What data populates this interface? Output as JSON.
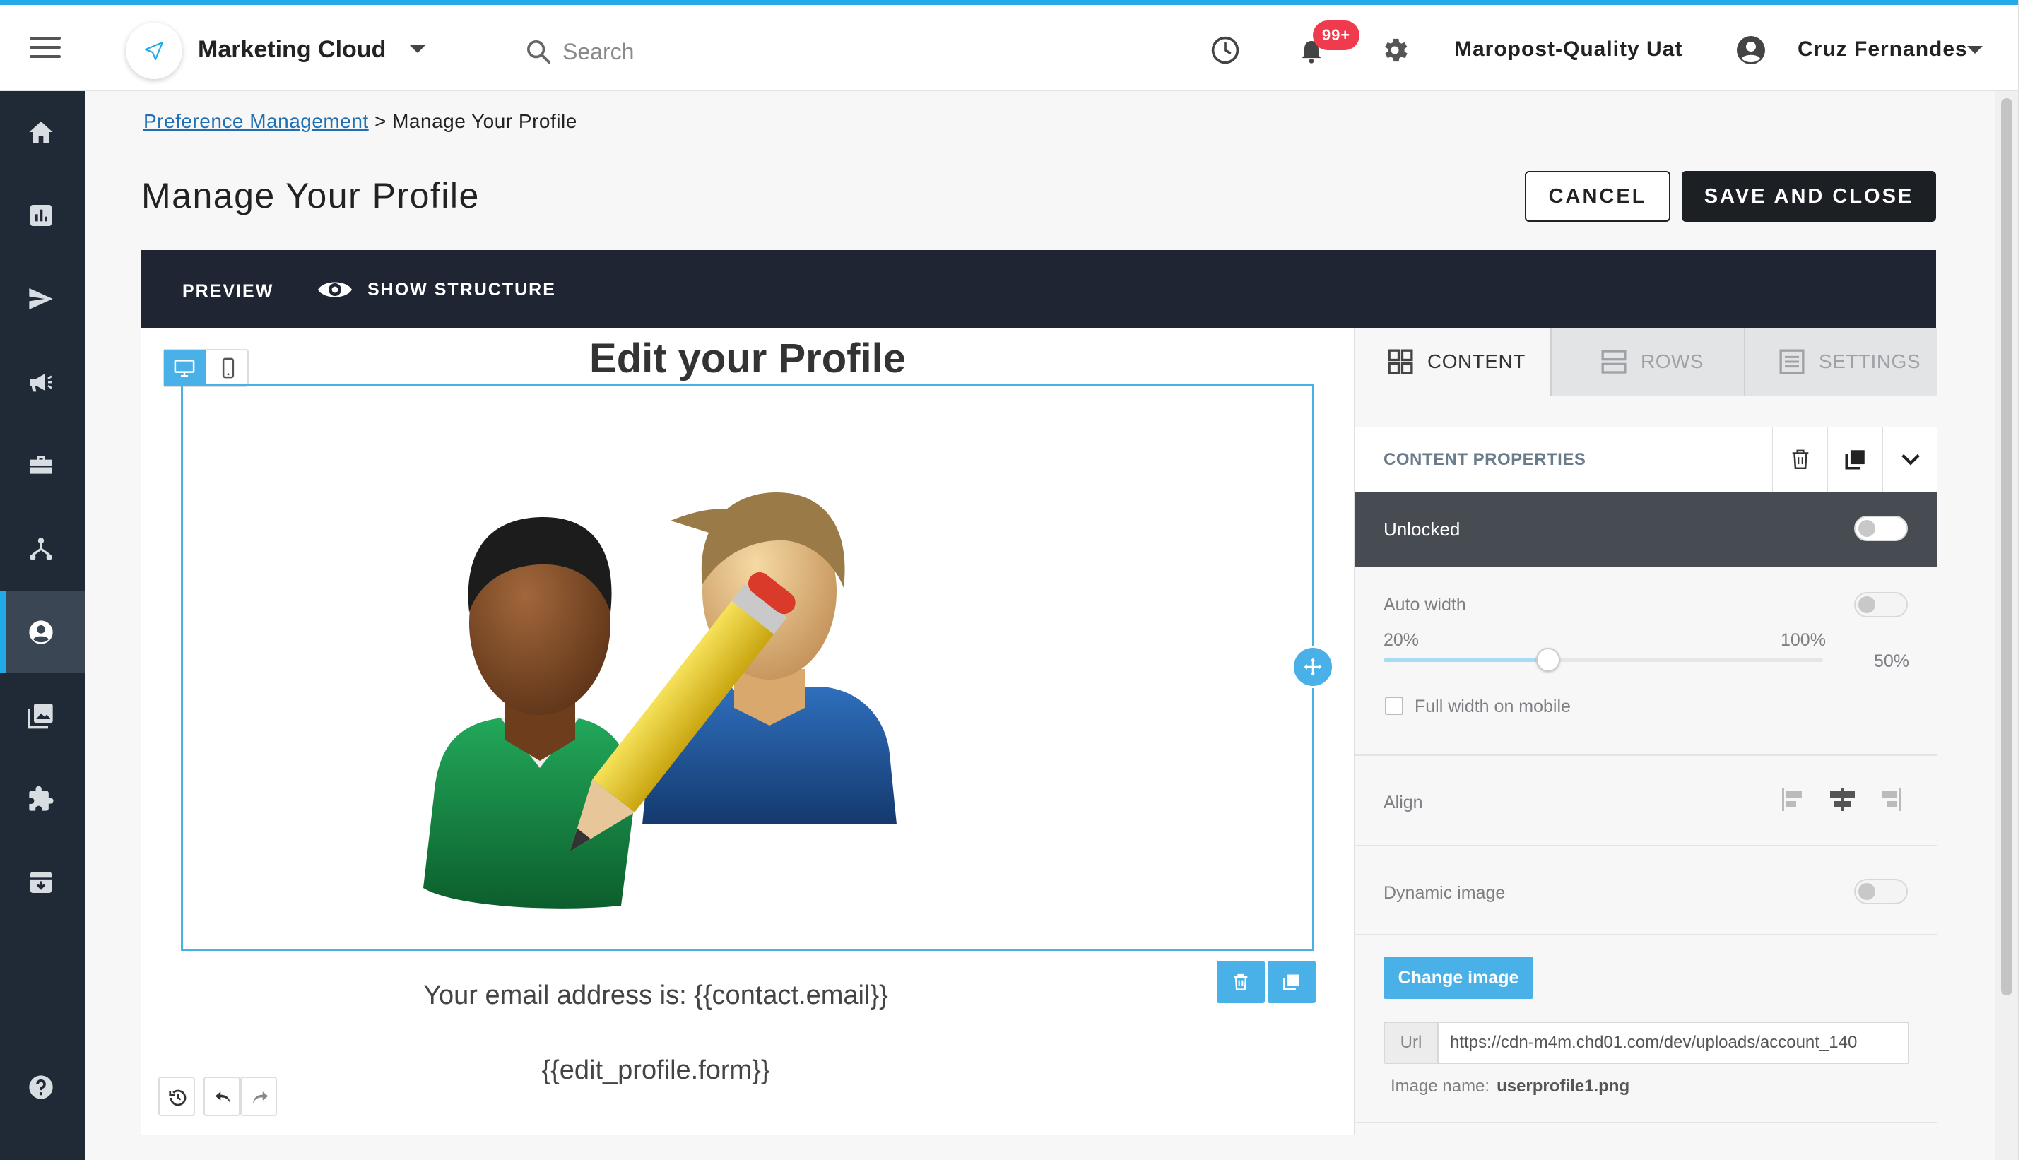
{
  "header": {
    "app_title": "Marketing Cloud",
    "search_placeholder": "Search",
    "notification_count": "99+",
    "account_name": "Maropost-Quality Uat",
    "user_name": "Cruz Fernandes"
  },
  "sidebar": {
    "items": [
      {
        "icon": "home-icon"
      },
      {
        "icon": "reports-icon"
      },
      {
        "icon": "send-icon"
      },
      {
        "icon": "megaphone-icon"
      },
      {
        "icon": "briefcase-icon"
      },
      {
        "icon": "journey-icon"
      },
      {
        "icon": "contact-icon",
        "active": true
      },
      {
        "icon": "gallery-icon"
      },
      {
        "icon": "puzzle-icon"
      },
      {
        "icon": "archive-icon"
      },
      {
        "icon": "help-icon"
      }
    ]
  },
  "breadcrumb": {
    "parent": "Preference Management",
    "separator": ">",
    "current": "Manage Your Profile"
  },
  "page": {
    "title": "Manage Your Profile",
    "cancel_label": "CANCEL",
    "save_label": "SAVE AND CLOSE"
  },
  "editor_bar": {
    "preview_label": "PREVIEW",
    "structure_label": "SHOW STRUCTURE"
  },
  "canvas": {
    "heading": "Edit your Profile",
    "email_text": "Your email address is: {{contact.email}}",
    "form_text": "{{edit_profile.form}}"
  },
  "panel": {
    "tabs": [
      {
        "label": "CONTENT",
        "icon": "grid-icon",
        "active": true
      },
      {
        "label": "ROWS",
        "icon": "rows-icon",
        "active": false
      },
      {
        "label": "SETTINGS",
        "icon": "settings-list-icon",
        "active": false
      }
    ],
    "properties_title": "CONTENT PROPERTIES",
    "unlocked_label": "Unlocked",
    "unlocked": false,
    "auto_width_label": "Auto width",
    "auto_width": false,
    "slider_min_label": "20%",
    "slider_max_label": "100%",
    "slider_value_label": "50%",
    "slider_value": 50,
    "full_width_mobile_label": "Full width on mobile",
    "full_width_mobile": false,
    "align_label": "Align",
    "align_selected": "center",
    "dynamic_image_label": "Dynamic image",
    "dynamic_image": false,
    "change_image_label": "Change image",
    "url_prefix": "Url",
    "url_value": "https://cdn-m4m.chd01.com/dev/uploads/account_140",
    "image_name_label": "Image name:",
    "image_name_value": "userprofile1.png"
  },
  "colors": {
    "accent": "#4ab1e8",
    "sidebar_bg": "#1f2a36",
    "editor_bar_bg": "#1f2533",
    "badge": "#ef3b4d"
  }
}
